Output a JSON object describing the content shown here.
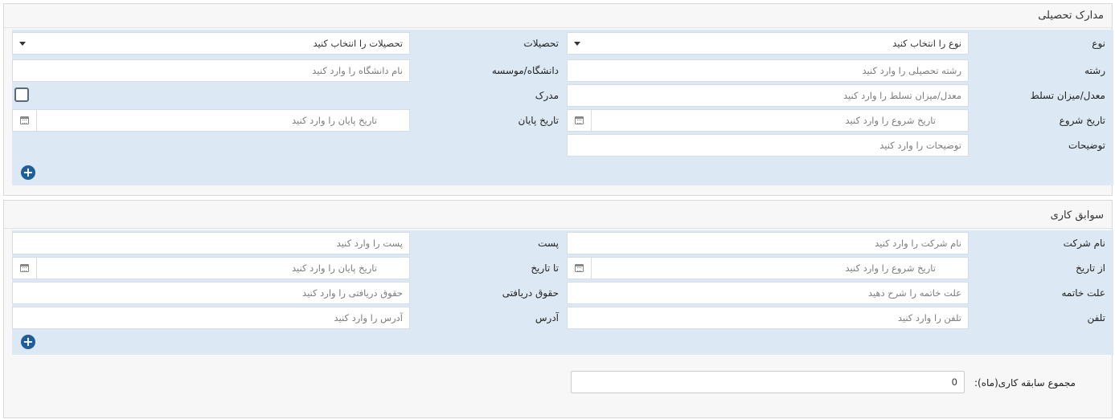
{
  "education": {
    "title": "مدارک تحصیلی",
    "type_label": "نوع",
    "type_placeholder": "نوع را انتخاب کنید",
    "degree_label": "تحصیلات",
    "degree_placeholder": "تحصیلات را انتخاب کنید",
    "major_label": "رشته",
    "major_placeholder": "رشته تحصیلی را وارد کنید",
    "university_label": "دانشگاه/موسسه",
    "university_placeholder": "نام دانشگاه را وارد کنید",
    "gpa_label": "معدل/میزان تسلط",
    "gpa_placeholder": "معدل/میزان تسلط را وارد کنید",
    "certificate_label": "مدرک",
    "start_label": "تاریخ شروع",
    "start_placeholder": "تاریخ شروع را وارد کنید",
    "end_label": "تاریخ پایان",
    "end_placeholder": "تاریخ پایان را وارد کنید",
    "desc_label": "توضیحات",
    "desc_placeholder": "توضیحات را وارد کنید",
    "add_icon": "+"
  },
  "work": {
    "title": "سوابق کاری",
    "company_label": "نام شرکت",
    "company_placeholder": "نام شرکت را وارد کنید",
    "position_label": "پست",
    "position_placeholder": "پست را وارد کنید",
    "from_label": "از تاریخ",
    "from_placeholder": "تاریخ شروع را وارد کنید",
    "to_label": "تا تاریخ",
    "to_placeholder": "تاریخ پایان را وارد کنید",
    "reason_label": "علت خاتمه",
    "reason_placeholder": "علت خاتمه را شرح دهید",
    "salary_label": "حقوق دریافتی",
    "salary_placeholder": "حقوق دریافتی را وارد کنید",
    "phone_label": "تلفن",
    "phone_placeholder": "تلفن را وارد کنید",
    "address_label": "آدرس",
    "address_placeholder": "آدرس را وارد کنید",
    "add_icon": "+",
    "total_label": "مجموع سابقه کاری(ماه):",
    "total_value": "0"
  },
  "colors": {
    "grid_bg": "#dce8f3",
    "panel_bg": "#f7f7f7",
    "add_button": "#1f5f99"
  }
}
